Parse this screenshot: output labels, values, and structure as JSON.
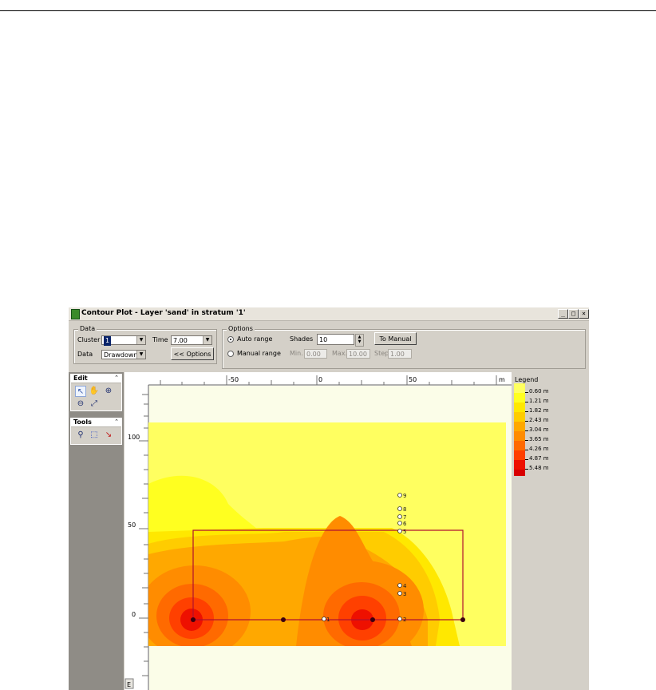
{
  "window": {
    "title": "Contour Plot - Layer 'sand' in stratum '1'",
    "controls": [
      "_",
      "□",
      "×"
    ]
  },
  "data_group": {
    "title": "Data",
    "cluster_label": "Cluster",
    "cluster_value": "1",
    "time_label": "Time",
    "time_value": "7.00",
    "data_label": "Data",
    "data_value": "Drawdown",
    "options_button": "<< Options"
  },
  "options_group": {
    "title": "Options",
    "auto_range": "Auto range",
    "manual_range": "Manual range",
    "selected_range": "auto",
    "shades_label": "Shades",
    "shades_value": "10",
    "to_manual_button": "To Manual",
    "min_label": "Min.",
    "min_value": "0.00",
    "max_label": "Max.",
    "max_value": "10.00",
    "step_label": "Step",
    "step_value": "1.00"
  },
  "edit_panel": {
    "title": "Edit",
    "collapse": "⌃",
    "tools": [
      "pointer-icon",
      "hand-icon",
      "zoom-in-icon",
      "zoom-out-icon",
      "zoom-extent-icon"
    ]
  },
  "tools_panel": {
    "title": "Tools",
    "collapse": "⌃",
    "tools": [
      "probe-icon",
      "select-rect-icon",
      "profile-line-icon"
    ]
  },
  "ruler": {
    "x_labels": [
      "-50",
      "0",
      "50",
      "m"
    ],
    "y_labels": [
      "100",
      "50",
      "0"
    ],
    "corner": "E"
  },
  "legend": {
    "title": "Legend",
    "entries": [
      {
        "label": "0.60 m",
        "color": "#ffff60"
      },
      {
        "label": "1.21 m",
        "color": "#ffff20"
      },
      {
        "label": "1.82 m",
        "color": "#ffe800"
      },
      {
        "label": "2.43 m",
        "color": "#ffcc00"
      },
      {
        "label": "3.04 m",
        "color": "#ffa800"
      },
      {
        "label": "3.65 m",
        "color": "#ff8c00"
      },
      {
        "label": "4.26 m",
        "color": "#ff6a00"
      },
      {
        "label": "4.87 m",
        "color": "#ff4000"
      },
      {
        "label": "5.48 m",
        "color": "#ee1000"
      }
    ]
  },
  "plot": {
    "background": "#fbfde8",
    "outer_color": "#ffff60",
    "boundary_color": "#b01030",
    "wells": [
      "1",
      "2",
      "3",
      "4",
      "5",
      "6",
      "7",
      "8",
      "9"
    ]
  }
}
